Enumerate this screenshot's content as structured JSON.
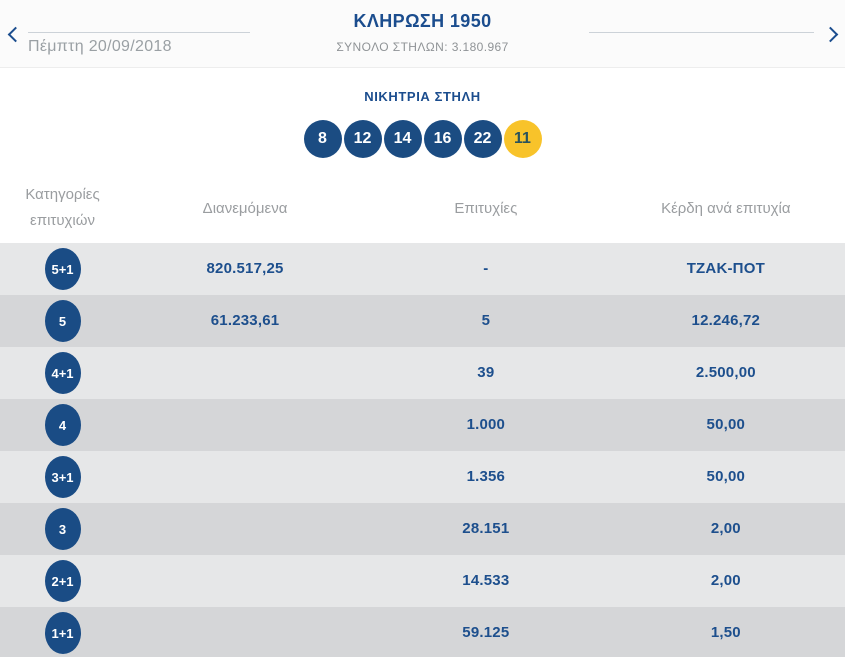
{
  "header": {
    "title": "ΚΛΗΡΩΣΗ 1950",
    "date": "Πέμπτη 20/09/2018",
    "total_columns_label": "ΣΥΝΟΛΟ ΣΤΗΛΩΝ:",
    "total_columns_value": "3.180.967"
  },
  "winning": {
    "title": "ΝΙΚΗΤΡΙΑ ΣΤΗΛΗ",
    "numbers": [
      "8",
      "12",
      "14",
      "16",
      "22"
    ],
    "joker": "11"
  },
  "table": {
    "headers": [
      "Κατηγορίες επιτυχιών",
      "Διανεμόμενα",
      "Επιτυχίες",
      "Κέρδη ανά επιτυχία"
    ],
    "rows": [
      {
        "category": "5+1",
        "distributed": "820.517,25",
        "wins": "-",
        "payout": "ΤΖΑΚ-ΠΟΤ"
      },
      {
        "category": "5",
        "distributed": "61.233,61",
        "wins": "5",
        "payout": "12.246,72"
      },
      {
        "category": "4+1",
        "distributed": "",
        "wins": "39",
        "payout": "2.500,00"
      },
      {
        "category": "4",
        "distributed": "",
        "wins": "1.000",
        "payout": "50,00"
      },
      {
        "category": "3+1",
        "distributed": "",
        "wins": "1.356",
        "payout": "50,00"
      },
      {
        "category": "3",
        "distributed": "",
        "wins": "28.151",
        "payout": "2,00"
      },
      {
        "category": "2+1",
        "distributed": "",
        "wins": "14.533",
        "payout": "2,00"
      },
      {
        "category": "1+1",
        "distributed": "",
        "wins": "59.125",
        "payout": "1,50"
      }
    ]
  },
  "colors": {
    "brand_blue": "#1b4d8e",
    "ball_blue": "#1b4c82",
    "joker_yellow": "#f8c32a",
    "row_light": "#e6e7e8",
    "row_dark": "#d5d6d8",
    "muted_gray": "#9a9da0"
  }
}
